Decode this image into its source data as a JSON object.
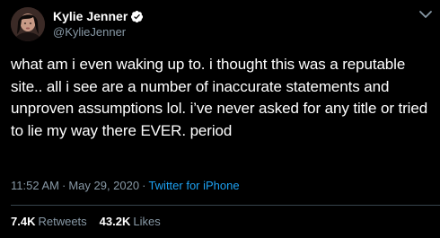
{
  "author": {
    "display_name": "Kylie Jenner",
    "handle": "@KylieJenner",
    "verified": true,
    "avatar": "profile-photo"
  },
  "tweet": {
    "text": "what am i even waking up to. i thought this was a reputable site.. all i see are a number of inaccurate statements and unproven assumptions lol. i’ve never asked for any title or tried to lie my way there EVER. period",
    "time": "11:52 AM",
    "separator": "·",
    "date": "May 29, 2020",
    "source": "Twitter for iPhone"
  },
  "stats": {
    "retweets_count": "7.4K",
    "retweets_label": "Retweets",
    "likes_count": "43.2K",
    "likes_label": "Likes"
  },
  "colors": {
    "background": "#000000",
    "text": "#ffffff",
    "secondary": "#8899a6",
    "accent": "#1da1f2",
    "divider": "#38444d"
  },
  "icons": {
    "verified": "verified-badge-icon",
    "more": "chevron-down-icon"
  }
}
